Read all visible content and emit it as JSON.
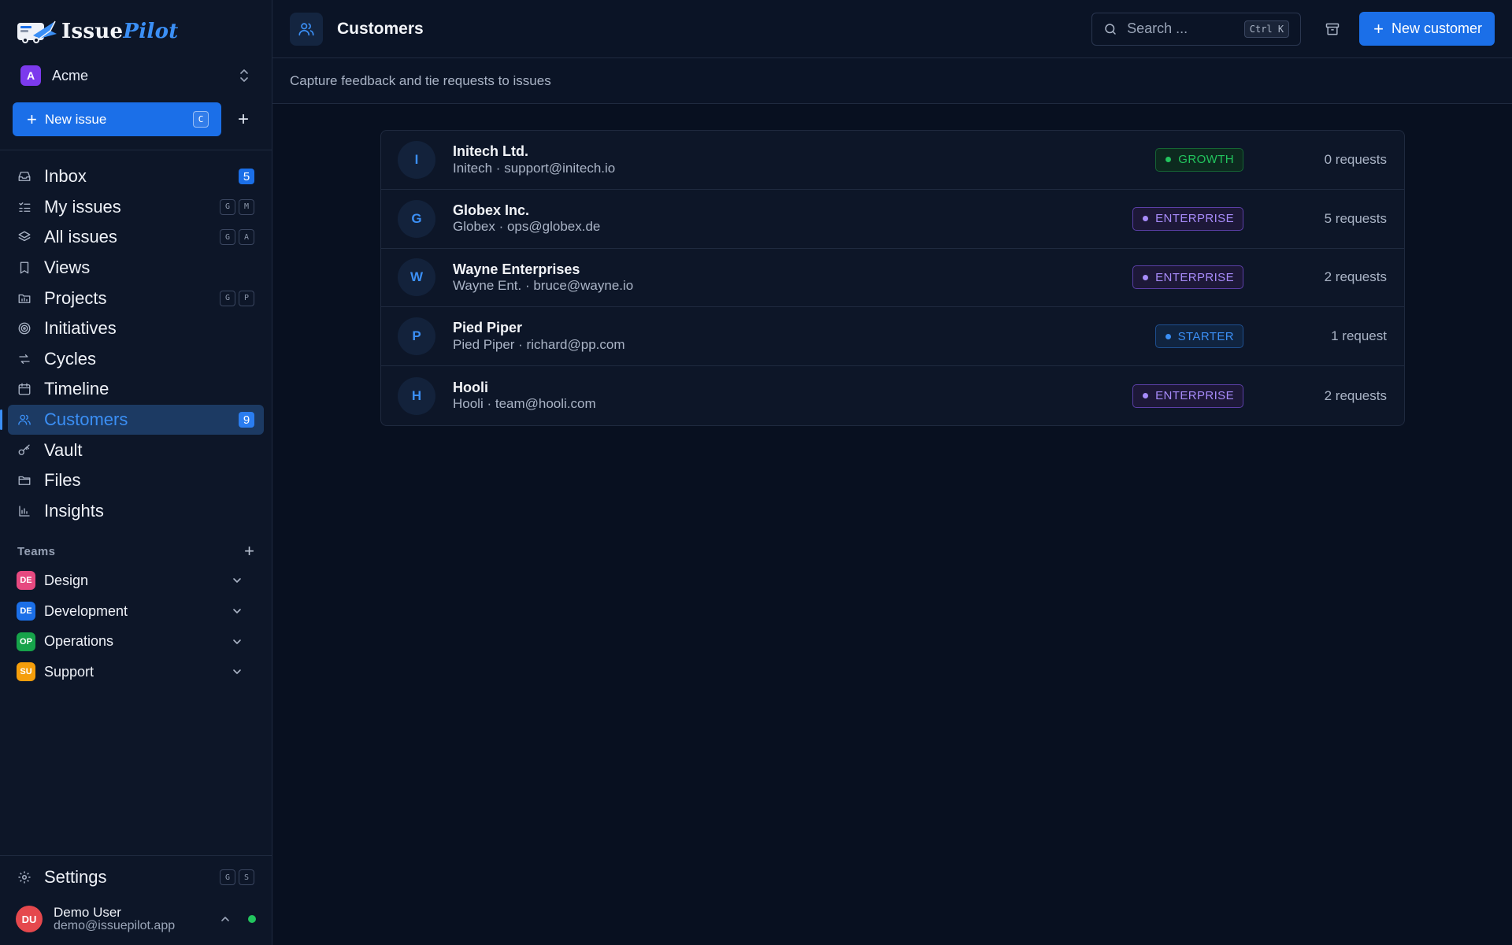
{
  "brand": {
    "name_part1": "Issue",
    "name_part2": "Pilot"
  },
  "workspace": {
    "initial": "A",
    "name": "Acme"
  },
  "new_issue": {
    "label": "New issue",
    "shortcut": "C"
  },
  "nav": [
    {
      "label": "Inbox",
      "icon": "inbox-icon",
      "badge": "5"
    },
    {
      "label": "My issues",
      "icon": "my-issues-icon",
      "keys": [
        "G",
        "M"
      ]
    },
    {
      "label": "All issues",
      "icon": "layers-icon",
      "keys": [
        "G",
        "A"
      ]
    },
    {
      "label": "Views",
      "icon": "bookmark-icon"
    },
    {
      "label": "Projects",
      "icon": "projects-icon",
      "keys": [
        "G",
        "P"
      ]
    },
    {
      "label": "Initiatives",
      "icon": "target-icon"
    },
    {
      "label": "Cycles",
      "icon": "cycle-icon"
    },
    {
      "label": "Timeline",
      "icon": "calendar-icon"
    },
    {
      "label": "Customers",
      "icon": "users-icon",
      "badge": "9",
      "active": true
    },
    {
      "label": "Vault",
      "icon": "key-icon"
    },
    {
      "label": "Files",
      "icon": "folder-icon"
    },
    {
      "label": "Insights",
      "icon": "bar-chart-icon"
    }
  ],
  "teams": {
    "title": "Teams",
    "items": [
      {
        "abbr": "DE",
        "name": "Design",
        "color": "#e64980"
      },
      {
        "abbr": "DE",
        "name": "Development",
        "color": "#1b6fe8"
      },
      {
        "abbr": "OP",
        "name": "Operations",
        "color": "#16a34a"
      },
      {
        "abbr": "SU",
        "name": "Support",
        "color": "#f59e0b"
      }
    ]
  },
  "settings": {
    "label": "Settings",
    "keys": [
      "G",
      "S"
    ]
  },
  "user": {
    "initials": "DU",
    "name": "Demo User",
    "email": "demo@issuepilot.app"
  },
  "header": {
    "title": "Customers",
    "subtitle": "Capture feedback and tie requests to issues"
  },
  "search": {
    "placeholder": "Search ...",
    "shortcut": "Ctrl K"
  },
  "new_customer": {
    "label": "New customer"
  },
  "tier_colors": {
    "GROWTH": {
      "text": "#22c55e",
      "border": "#166534",
      "bg": "#0d2a1f"
    },
    "ENTERPRISE": {
      "text": "#a78bfa",
      "border": "#5b3fa6",
      "bg": "#1d1838"
    },
    "STARTER": {
      "text": "#3b8ff5",
      "border": "#1e4f8f",
      "bg": "#102440"
    }
  },
  "customers": [
    {
      "initial": "I",
      "name": "Initech Ltd.",
      "subtitle": "Initech · support@initech.io",
      "tier": "GROWTH",
      "requests": "0 requests"
    },
    {
      "initial": "G",
      "name": "Globex Inc.",
      "subtitle": "Globex · ops@globex.de",
      "tier": "ENTERPRISE",
      "requests": "5 requests"
    },
    {
      "initial": "W",
      "name": "Wayne Enterprises",
      "subtitle": "Wayne Ent. · bruce@wayne.io",
      "tier": "ENTERPRISE",
      "requests": "2 requests"
    },
    {
      "initial": "P",
      "name": "Pied Piper",
      "subtitle": "Pied Piper · richard@pp.com",
      "tier": "STARTER",
      "requests": "1 request"
    },
    {
      "initial": "H",
      "name": "Hooli",
      "subtitle": "Hooli · team@hooli.com",
      "tier": "ENTERPRISE",
      "requests": "2 requests"
    }
  ]
}
